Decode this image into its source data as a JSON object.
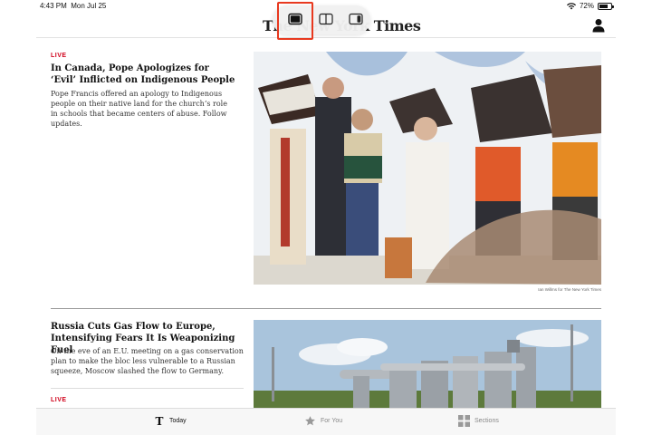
{
  "status_bar": {
    "time": "4:43 PM",
    "date": "Mon Jul 25",
    "battery_percent": "72%",
    "battery_level": 0.72
  },
  "header": {
    "masthead": "The New York Times"
  },
  "multitasking": {
    "options": [
      "full-screen",
      "split-view",
      "slide-over"
    ],
    "selected": "full-screen"
  },
  "articles": [
    {
      "live_label": "LIVE",
      "headline": "In Canada, Pope Apologizes for ‘Evil’ Inflicted on Indigenous People",
      "summary": "Pope Francis offered an apology to Indigenous people on their native land for the church’s role in schools that became centers of abuse. Follow updates.",
      "photo_credit": "Ian Willms for The New York Times"
    },
    {
      "headline": "Russia Cuts Gas Flow to Europe, Intensifying Fears It Is Weaponizing Fuel",
      "summary": "On the eve of an E.U. meeting on a gas conservation plan to make the bloc less vulnerable to a Russian squeeze, Moscow slashed the flow to Germany."
    },
    {
      "live_label": "LIVE"
    }
  ],
  "tab_bar": {
    "tabs": [
      {
        "label": "Today",
        "icon": "nyt-t-logo-icon",
        "selected": true
      },
      {
        "label": "For You",
        "icon": "star-icon",
        "selected": false
      },
      {
        "label": "Sections",
        "icon": "grid-icon",
        "selected": false
      }
    ]
  },
  "colors": {
    "live": "#d0021b",
    "highlight": "#e8391f",
    "tab_active": "#121212",
    "tab_inactive": "#888888"
  }
}
